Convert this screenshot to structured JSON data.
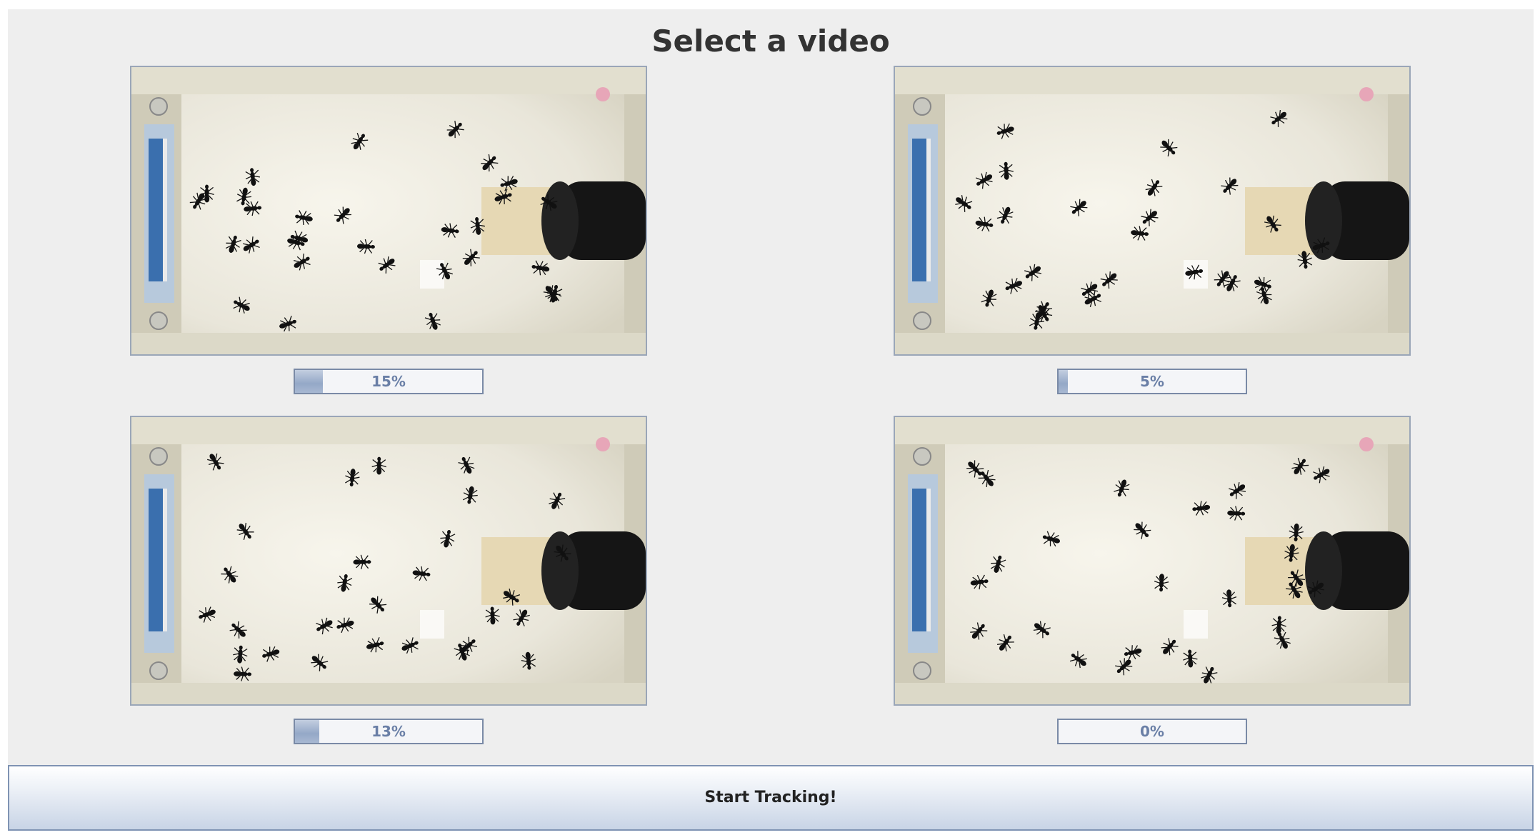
{
  "header": {
    "title": "Select a video"
  },
  "videos": [
    {
      "progress_label": "15%",
      "progress": 0.15
    },
    {
      "progress_label": "5%",
      "progress": 0.05
    },
    {
      "progress_label": "13%",
      "progress": 0.13
    },
    {
      "progress_label": "0%",
      "progress": 0.0
    }
  ],
  "footer": {
    "start_label": "Start Tracking!"
  }
}
